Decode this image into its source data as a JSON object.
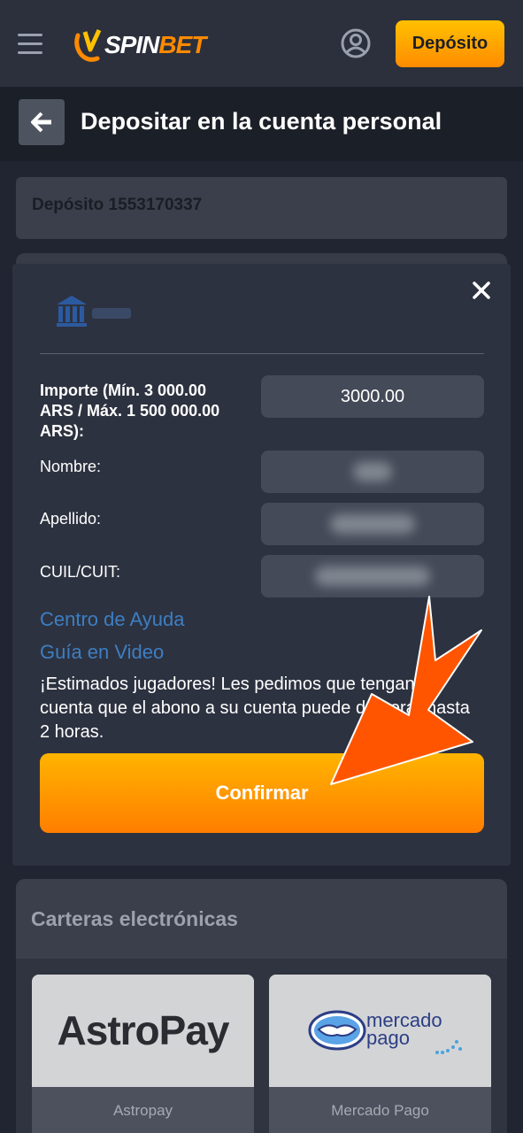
{
  "header": {
    "menu_icon": "hamburger-icon",
    "logo": {
      "prefix": "SPIN",
      "suffix": "BET",
      "accent": "#ff8a00"
    },
    "account_icon": "user-circle-icon",
    "deposit_label": "Depósito"
  },
  "title_bar": {
    "back_icon": "arrow-left-icon",
    "title": "Depositar en la cuenta personal"
  },
  "deposit_ref": "Depósito 1553170337",
  "modal": {
    "bank_logo_icon": "bank-building-icon",
    "close_icon": "close-icon",
    "fields": [
      {
        "label": "Importe (Mín. 3 000.00 ARS / Máx. 1 500 000.00 ARS):",
        "value": "3000.00"
      },
      {
        "label": "Nombre:",
        "value": ""
      },
      {
        "label": "Apellido:",
        "value": ""
      },
      {
        "label": "CUIL/CUIT:",
        "value": ""
      }
    ],
    "help_link": "Centro de Ayuda",
    "video_link": "Guía en Video",
    "notice": "¡Estimados jugadores! Les pedimos que tengan en cuenta que el abono a su cuenta puede demorar hasta 2 horas.",
    "confirm_label": "Confirmar"
  },
  "wallets": {
    "title": "Carteras electrónicas",
    "items": [
      {
        "logo_text": "AstroPay",
        "name": "Astropay"
      },
      {
        "logo_text": "mercado pago",
        "name": "Mercado Pago"
      }
    ]
  },
  "colors": {
    "accent": "#ff9a00",
    "link": "#3d7ec2",
    "background": "#202531"
  }
}
